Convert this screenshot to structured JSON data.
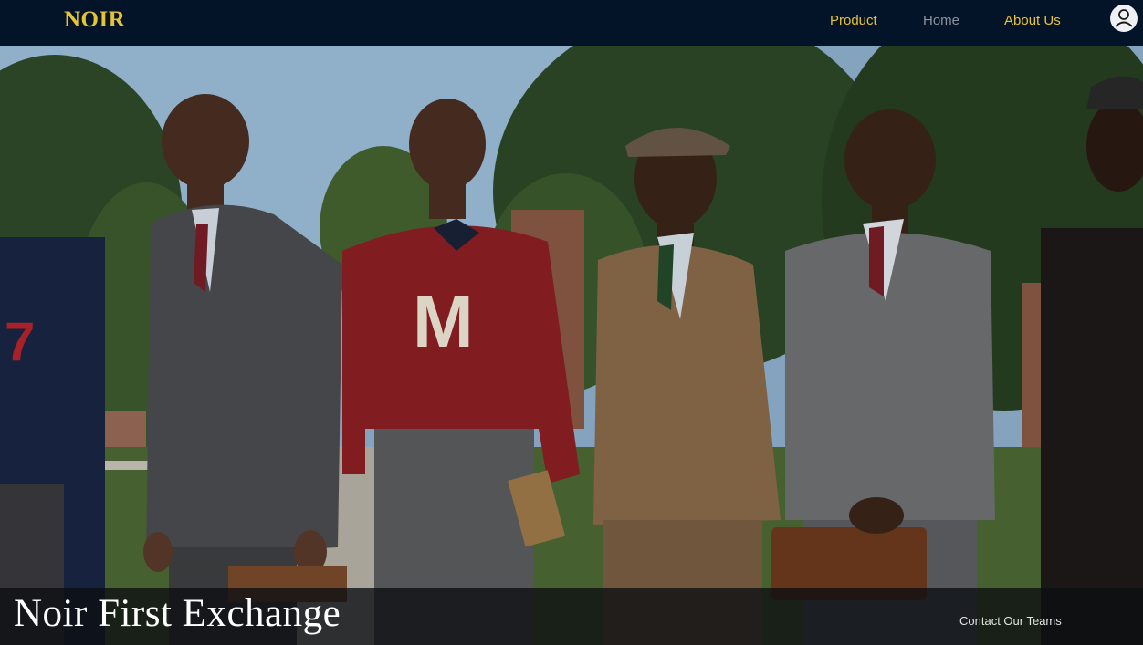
{
  "navbar": {
    "logo": "NOIR",
    "links": [
      {
        "label": "Product",
        "color": "#e6c235"
      },
      {
        "label": "Home",
        "color": "#8c93a0"
      },
      {
        "label": "About Us",
        "color": "#e6c235"
      }
    ],
    "user_icon": "user-avatar-icon"
  },
  "hero": {
    "title": "Noir First Exchange",
    "sweater_letter": "M",
    "jersey_number": "7",
    "contact_link": "Contact Our Teams"
  },
  "colors": {
    "nav_background": "#031428",
    "accent": "#e6c235"
  }
}
